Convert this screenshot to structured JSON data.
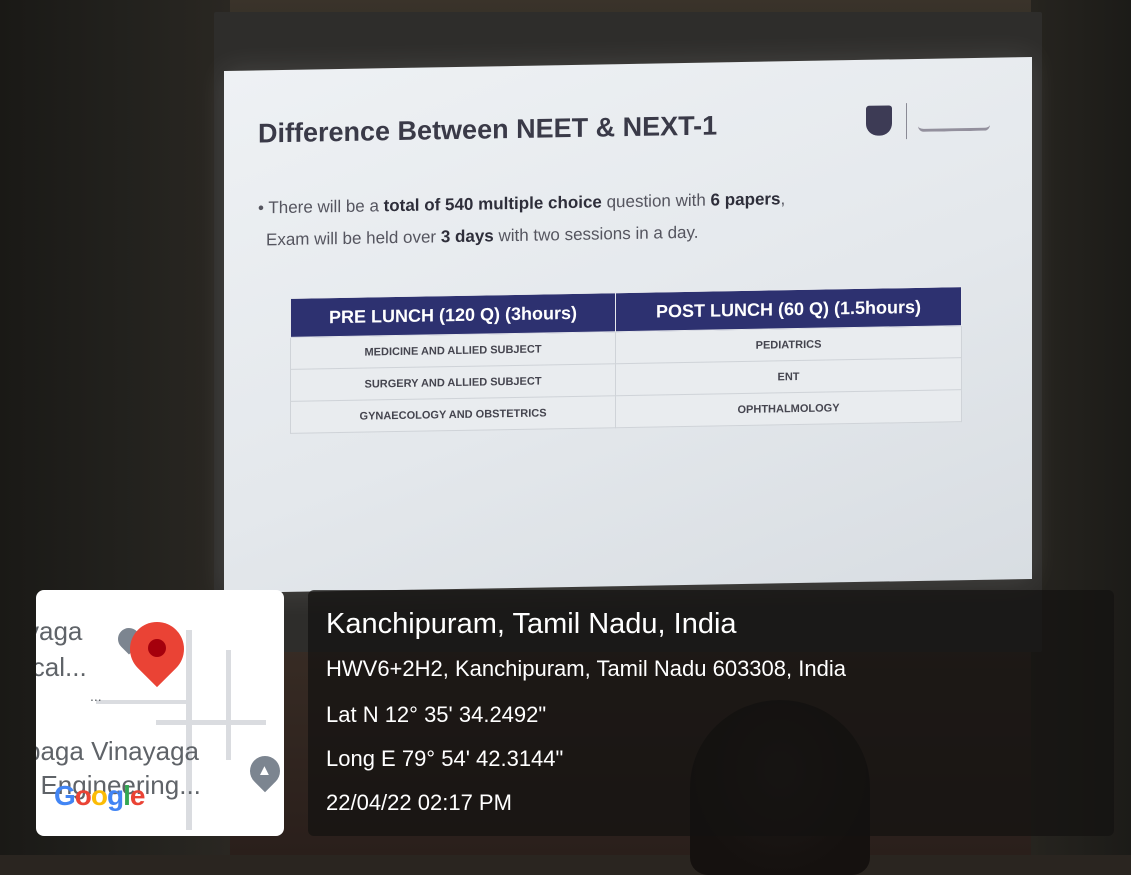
{
  "slide": {
    "title": "Difference Between NEET & NEXT-1",
    "bullet_parts": [
      "• There will be a ",
      "total of 540 multiple choice",
      " question with ",
      "6 papers",
      ",",
      "Exam will be held over ",
      "3 days",
      " with two sessions in a day."
    ],
    "table": {
      "headers": [
        "PRE LUNCH (120 Q) (3hours)",
        "POST LUNCH (60 Q) (1.5hours)"
      ],
      "rows": [
        [
          "MEDICINE AND ALLIED SUBJECT",
          "PEDIATRICS"
        ],
        [
          "SURGERY AND ALLIED SUBJECT",
          "ENT"
        ],
        [
          "GYNAECOLOGY AND OBSTETRICS",
          "OPHTHALMOLOGY"
        ]
      ]
    }
  },
  "map": {
    "label_1": "yaga",
    "label_2": "ical...",
    "label_3": "...",
    "label_4": "paga Vinayaga",
    "label_5": "f Engineering...",
    "logo": "Google",
    "icons": [
      "map-pin-icon",
      "education-pin-icon"
    ]
  },
  "location": {
    "place": "Kanchipuram, Tamil Nadu, India",
    "address": "HWV6+2H2, Kanchipuram, Tamil Nadu 603308, India",
    "lat": "Lat N 12° 35' 34.2492\"",
    "long": "Long E 79° 54' 42.3144\"",
    "datetime": "22/04/22 02:17 PM"
  },
  "colors": {
    "table_header": "#2d3170",
    "map_pin": "#ea4335",
    "panel_bg": "#141210"
  }
}
